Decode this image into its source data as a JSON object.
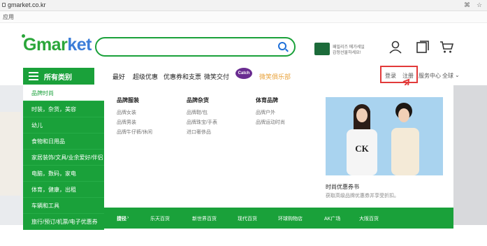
{
  "browser": {
    "url": "gmarket.co.kr",
    "bookmark": "应用"
  },
  "header": {
    "logo": {
      "part1": "Gmar",
      "part2": "ket"
    },
    "search": {
      "placeholder": ""
    },
    "promo_text": [
      "패밀리즈 메가세일",
      "감정선물하세요!"
    ]
  },
  "nav": {
    "all_categories": "所有类别",
    "items": [
      "最好",
      "超级优惠",
      "优惠券和支票",
      "微笑交付"
    ],
    "catch_badge": "Catch",
    "club": "微笑俱乐部",
    "right": [
      "登录",
      "注册",
      "服务中心",
      "全球"
    ]
  },
  "categories": [
    "品牌时尚",
    "时装，杂货，美容",
    "幼儿",
    "食物和日用品",
    "家居装饰/文具/业余爱好/伴侣",
    "电脑，数码，家电",
    "体育，健康，出租",
    "车辆和工具",
    "旅行/预订/机票/电子优惠券"
  ],
  "columns": [
    {
      "header": "品牌服装",
      "items": [
        "品牌女装",
        "品牌男装",
        "品牌牛仔裤/休闲"
      ]
    },
    {
      "header": "品牌杂货",
      "items": [
        "品牌鞋/包",
        "品牌珠宝/手表",
        "进口奢侈品"
      ]
    },
    {
      "header": "体育品牌",
      "items": [
        "品牌户外",
        "品牌运动时尚"
      ]
    }
  ],
  "ad": {
    "title": "时尚优惠券书",
    "subtitle": "获取高级品牌优惠券并享受折扣。",
    "shirt_text": "CK"
  },
  "dept": {
    "label": "捷径",
    "items": [
      "乐天百货",
      "新世界百货",
      "现代百货",
      "环球购物店",
      "AK广场",
      "大阪百货"
    ]
  }
}
